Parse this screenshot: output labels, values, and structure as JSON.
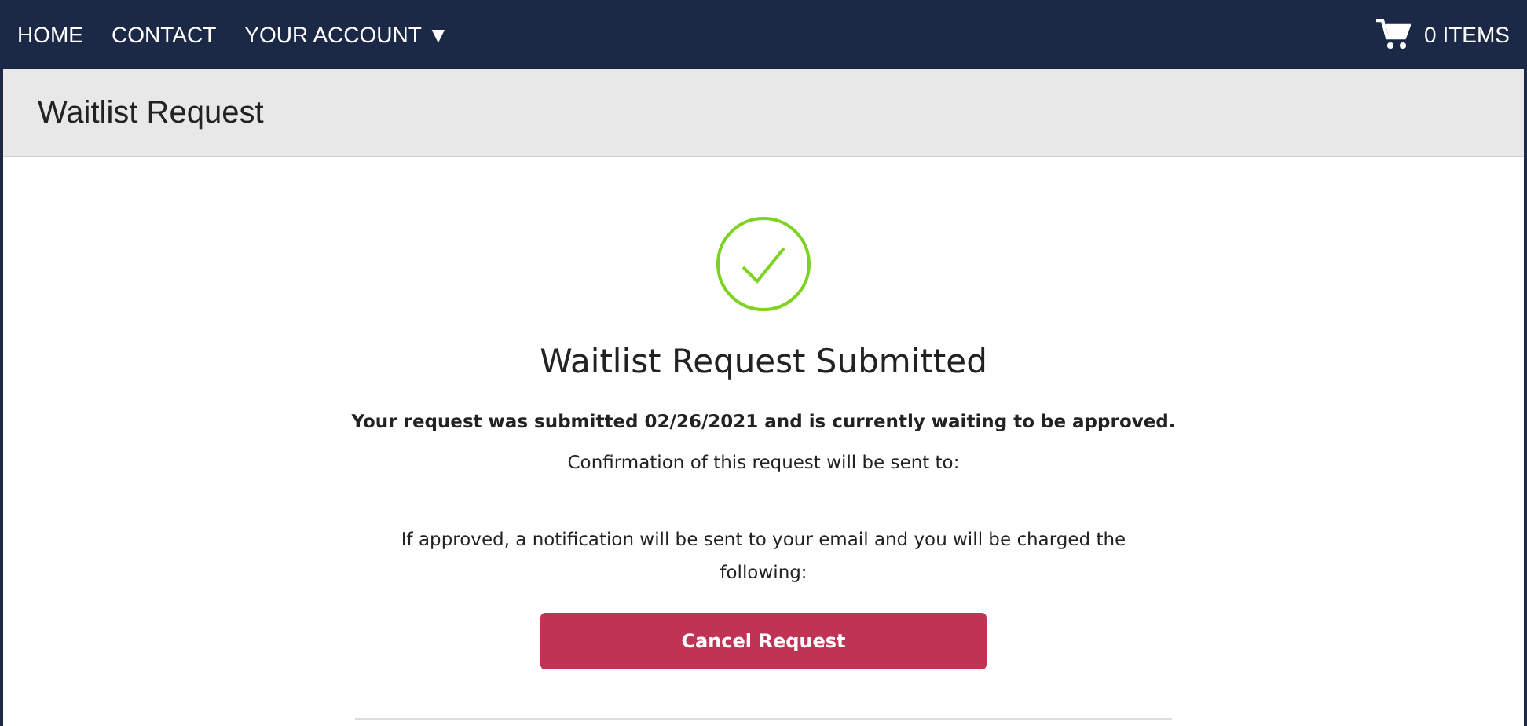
{
  "nav": {
    "links": [
      {
        "label": "HOME"
      },
      {
        "label": "CONTACT"
      },
      {
        "label": "YOUR ACCOUNT ▼"
      }
    ],
    "cart": "0 ITEMS"
  },
  "panel": {
    "title": "Waitlist Request"
  },
  "confirmation": {
    "heading": "Waitlist Request Submitted",
    "status": "Your request was submitted 02/26/2021 and is currently waiting to be approved.",
    "sent_to": "Confirmation of this request will be sent to:",
    "charge_note": "If approved, a notification will be sent to your email and you will be charged the following:",
    "button": "Cancel Request"
  }
}
